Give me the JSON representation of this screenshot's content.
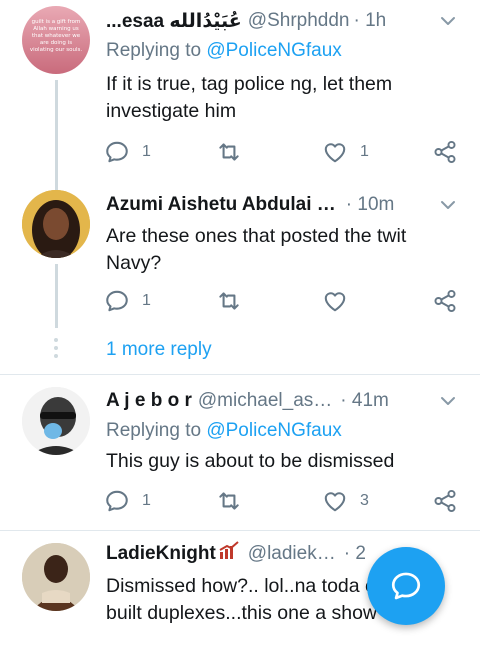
{
  "tweets": [
    {
      "name": "...esaa عُبَيْدُالله",
      "handle": "@Shrphddn",
      "time": "· 1h",
      "replying_prefix": "Replying to ",
      "replying_to": "@PoliceNGfaux",
      "text": "If it is true, tag police ng, let them investigate him",
      "replies": "1",
      "retweets": "",
      "likes": "1",
      "avatar_text": "guilt is a gift from Allah warning us that whatever we are doing is violating our souls."
    },
    {
      "name": "Azumi Aishetu Abdulai …",
      "handle": "",
      "time": "· 10m",
      "text": "Are these ones that posted the twit Navy?",
      "replies": "1",
      "retweets": "",
      "likes": ""
    },
    {
      "name": "A j e b o r",
      "handle": "@michael_as…",
      "time": "· 41m",
      "replying_prefix": "Replying to ",
      "replying_to": "@PoliceNGfaux",
      "text": "This guy is about to be dismissed",
      "replies": "1",
      "retweets": "",
      "likes": "3"
    },
    {
      "name": "LadieKnight",
      "handle": "@ladiek…",
      "time": "· 2",
      "text": "Dismissed how?.. lol..na toda  e have built duplexes...this one  a show off"
    }
  ],
  "more_replies": "1 more reply",
  "icons": {
    "reply": "reply-icon",
    "retweet": "retweet-icon",
    "like": "heart-icon",
    "share": "share-icon",
    "caret": "chevron-down-icon",
    "compose": "compose-reply-icon"
  },
  "colors": {
    "accent": "#1da1f2",
    "secondary_text": "#657786",
    "divider": "#e1e8ed"
  }
}
